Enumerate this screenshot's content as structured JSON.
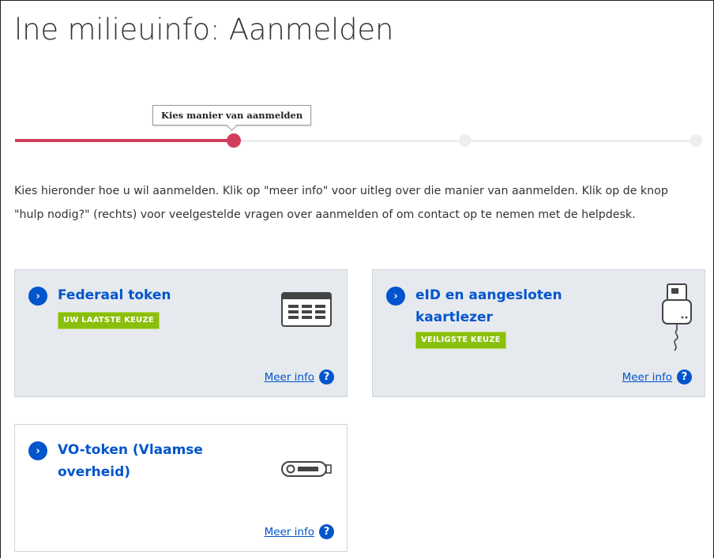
{
  "page": {
    "title": "lne milieuinfo: Aanmelden"
  },
  "stepper": {
    "current_step_label": "Kies manier van aanmelden",
    "current_step": 1,
    "total_steps": 3
  },
  "intro": {
    "text": "Kies hieronder hoe u wil aanmelden. Klik op \"meer info\" voor uitleg over die manier van aanmelden. Klik op de knop \"hulp nodig?\" (rechts) voor veelgestelde vragen over aanmelden of om contact op te nemen met de helpdesk."
  },
  "options": [
    {
      "title": "Federaal token",
      "badge": "UW LAATSTE KEUZE",
      "more_info": "Meer info",
      "icon": "token-card-icon"
    },
    {
      "title": "eID en aangesloten kaartlezer",
      "badge": "VEILIGSTE KEUZE",
      "more_info": "Meer info",
      "icon": "card-reader-icon"
    },
    {
      "title": "VO-token (Vlaamse overheid)",
      "badge": "",
      "more_info": "Meer info",
      "icon": "usb-token-icon"
    }
  ],
  "colors": {
    "accent": "#d03e5c",
    "link": "#0055cc",
    "badge": "#8bbf0d",
    "card_grey": "#e6e9ee"
  }
}
